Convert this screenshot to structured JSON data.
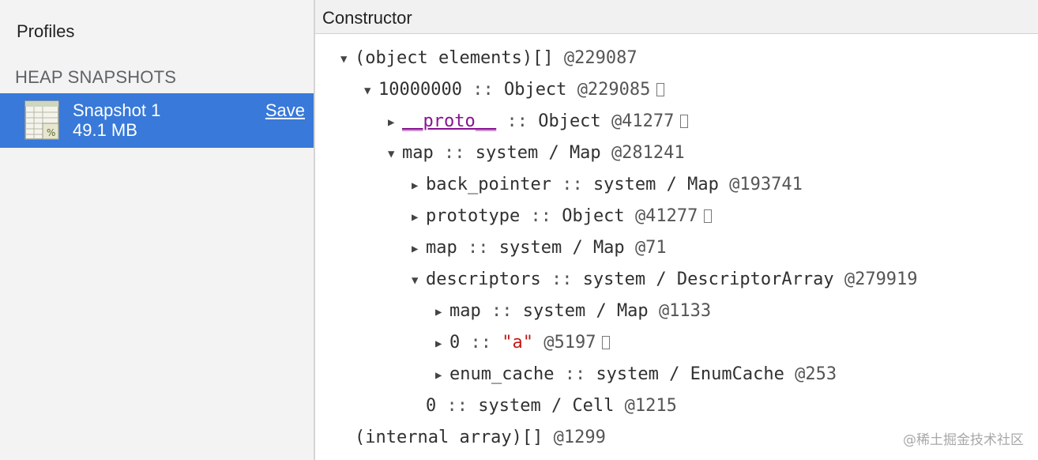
{
  "sidebar": {
    "title": "Profiles",
    "section_header": "HEAP SNAPSHOTS",
    "snapshot": {
      "name": "Snapshot 1",
      "size": "49.1 MB",
      "save_label": "Save",
      "icon": "spreadsheet-percent-icon"
    }
  },
  "main": {
    "column_header": "Constructor",
    "rows": [
      {
        "expander": "expanded",
        "name": "(object elements)[]",
        "address": "@229087"
      },
      {
        "expander": "expanded",
        "name": "10000000",
        "sep": "::",
        "type": "Object",
        "address": "@229085",
        "ref": true
      },
      {
        "expander": "collapsed",
        "name": "__proto__",
        "sep": "::",
        "type": "Object",
        "address": "@41277",
        "ref": true
      },
      {
        "expander": "expanded",
        "name": "map",
        "sep": "::",
        "type": "system / Map",
        "address": "@281241"
      },
      {
        "expander": "collapsed",
        "name": "back_pointer",
        "sep": "::",
        "type": "system / Map",
        "address": "@193741"
      },
      {
        "expander": "collapsed",
        "name": "prototype",
        "sep": "::",
        "type": "Object",
        "address": "@41277",
        "ref": true
      },
      {
        "expander": "collapsed",
        "name": "map",
        "sep": "::",
        "type": "system / Map",
        "address": "@71"
      },
      {
        "expander": "expanded",
        "name": "descriptors",
        "sep": "::",
        "type": "system / DescriptorArray",
        "address": "@279919"
      },
      {
        "expander": "collapsed",
        "name": "map",
        "sep": "::",
        "type": "system / Map",
        "address": "@1133"
      },
      {
        "expander": "collapsed",
        "name": "0",
        "sep": "::",
        "type": "\"a\"",
        "address": "@5197",
        "ref": true
      },
      {
        "expander": "collapsed",
        "name": "enum_cache",
        "sep": "::",
        "type": "system / EnumCache",
        "address": "@253"
      },
      {
        "expander": "none",
        "name": "0",
        "sep": "::",
        "type": "system / Cell",
        "address": "@1215"
      },
      {
        "expander": "none",
        "name": "(internal array)[]",
        "address": "@1299"
      }
    ]
  },
  "watermark": "@稀土掘金技术社区",
  "colors": {
    "selected": "#3879d9",
    "proto_purple": "#881391",
    "string_red": "#c41a16"
  }
}
